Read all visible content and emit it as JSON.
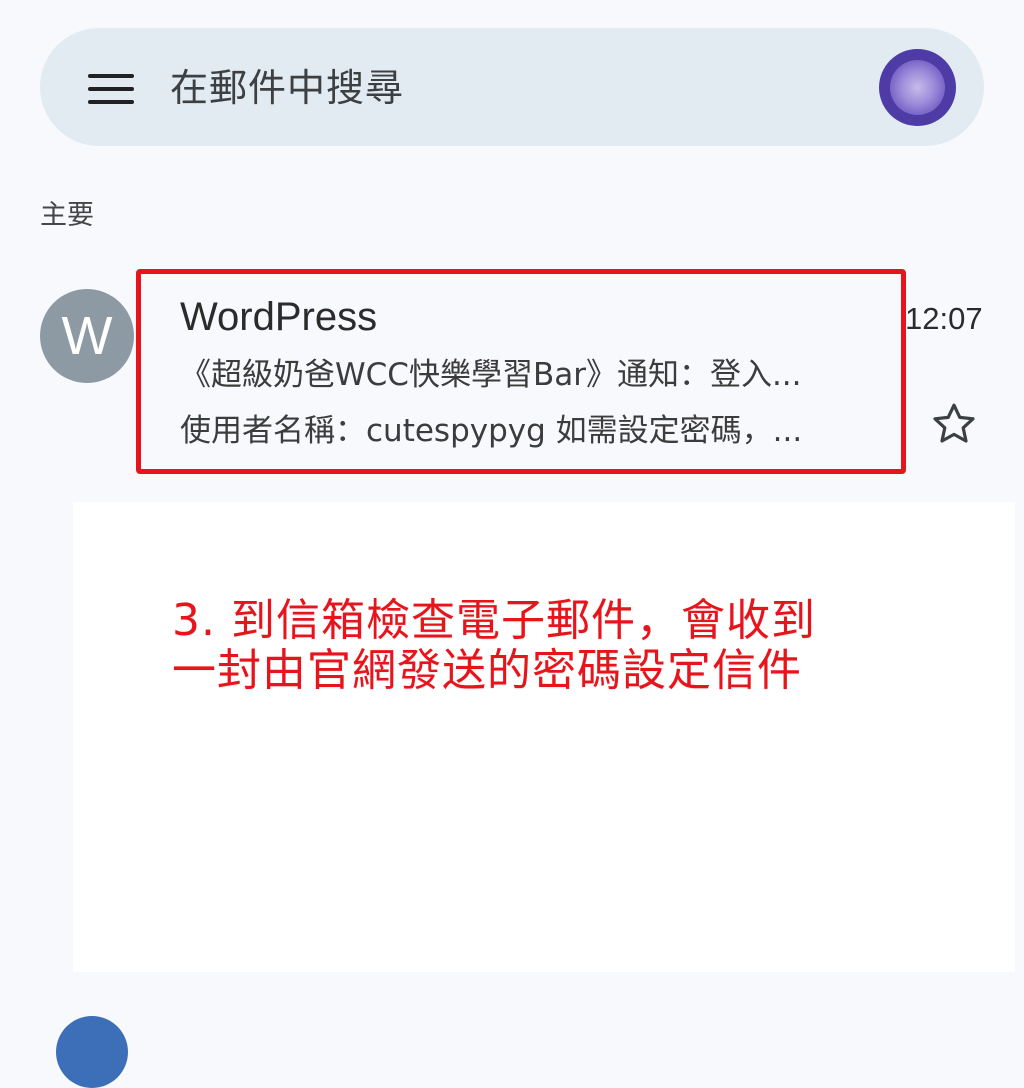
{
  "search": {
    "placeholder": "在郵件中搜尋",
    "menu_icon": "menu-icon",
    "account_avatar_color": "#4e3ba6"
  },
  "section": {
    "label": "主要"
  },
  "email": {
    "sender_initial": "W",
    "sender": "WordPress",
    "time": "12:07",
    "subject": "《超級奶爸WCC快樂學習Bar》通知：登入...",
    "snippet": "使用者名稱：cutespypyg 如需設定密碼，...",
    "star_icon": "star-outline-icon"
  },
  "annotation": {
    "line1": "3. 到信箱檢查電子郵件，會收到",
    "line2": "一封由官網發送的密碼設定信件",
    "color": "#e8141c"
  },
  "colors": {
    "background": "#f8f9fd",
    "search_bar": "#e2ebf1",
    "sender_avatar": "#8d9aa3",
    "highlight": "#e8141c"
  }
}
